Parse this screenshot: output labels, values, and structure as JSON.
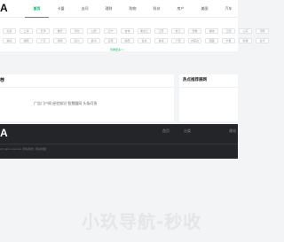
{
  "header": {
    "logo": "A",
    "nav": [
      {
        "label": "首页",
        "active": true
      },
      {
        "label": "卡盟",
        "active": false
      },
      {
        "label": "去问",
        "active": false
      },
      {
        "label": "理财",
        "active": false
      },
      {
        "label": "购物",
        "active": false
      },
      {
        "label": "科技",
        "active": false
      },
      {
        "label": "房产",
        "active": false
      },
      {
        "label": "美图",
        "active": false
      },
      {
        "label": "汽车",
        "active": false
      }
    ]
  },
  "regions": {
    "row1": [
      "北京",
      "上海",
      "天津",
      "重庆",
      "河北",
      "山西",
      "辽宁",
      "吉林",
      "黑龙江",
      "江苏",
      "浙江",
      "安徽",
      "福建",
      "江西",
      "山东",
      "河南"
    ],
    "row2": [
      "湖北",
      "湖南",
      "广东",
      "海南",
      "四川",
      "贵州",
      "云南",
      "陕西",
      "甘肃",
      "青海",
      "广西",
      "内蒙古",
      "西藏",
      "宁夏",
      "新疆",
      "台湾"
    ],
    "more_label": "查看更多>>"
  },
  "main_card": {
    "title": "荐",
    "text": "广告门户网 经验知识 智慧圆网 头条问答"
  },
  "side_card": {
    "title": "热点推荐展网"
  },
  "footer": {
    "logo": "A",
    "nav": [
      "首页",
      "分类",
      "建站"
    ],
    "copyright": "All rights reserved. 网站导航 | 网站地图"
  },
  "banner": {
    "text": "小玖导航-秒收"
  },
  "colors": {
    "accent": "#17b86b",
    "footer_bg": "#232528",
    "page_bg": "#f3f4f6"
  }
}
